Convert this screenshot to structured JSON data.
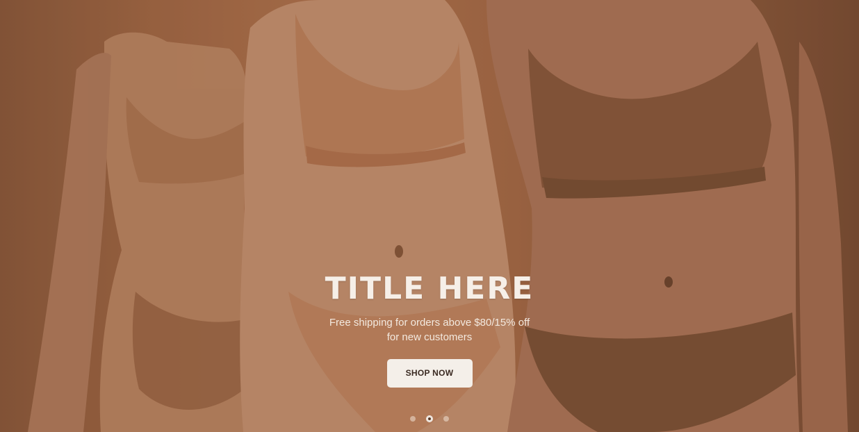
{
  "hero": {
    "title": "TITLE HERE",
    "subtitle": "Free shipping for orders above $80/15% off for new customers",
    "cta_label": "SHOP NOW",
    "image_alt": "three models wearing nude-toned bralettes and briefs"
  },
  "carousel": {
    "slides": 3,
    "active_slide": 2
  },
  "colors": {
    "title": "#f6efe8",
    "button_bg": "#f4efe9",
    "button_text": "#3a2a22",
    "background": "#a56b47"
  }
}
